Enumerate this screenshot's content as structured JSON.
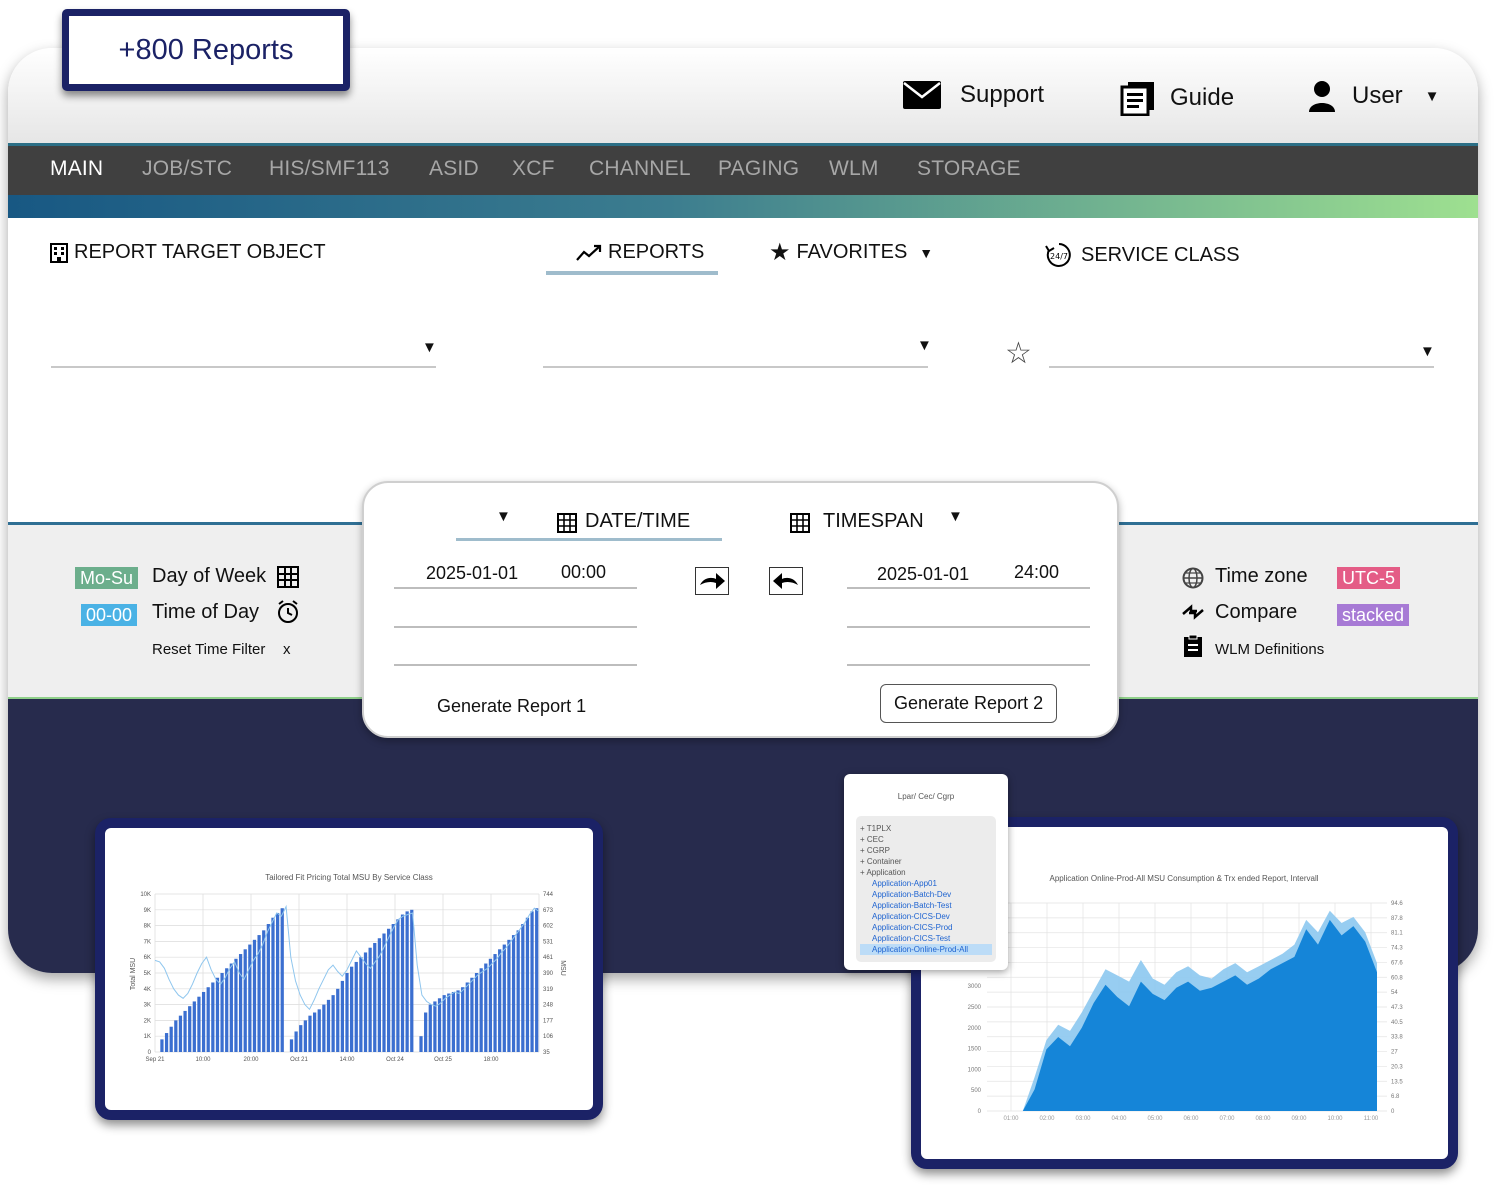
{
  "badge": {
    "text": "+800 Reports"
  },
  "header": {
    "support": "Support",
    "guide": "Guide",
    "user": "User",
    "icons": {
      "support": "envelope-icon",
      "guide": "book-icon",
      "user": "user-icon"
    }
  },
  "nav": {
    "tabs": [
      "MAIN",
      "JOB/STC",
      "HIS/SMF113",
      "ASID",
      "XCF",
      "CHANNEL",
      "PAGING",
      "WLM",
      "STORAGE"
    ],
    "active": "MAIN"
  },
  "sections": {
    "report_target": "REPORT TARGET OBJECT",
    "reports": "REPORTS",
    "favorites": "FAVORITES",
    "service_class": "SERVICE CLASS"
  },
  "filters": {
    "day_of_week_pill": "Mo-Su",
    "day_of_week_label": "Day of Week",
    "time_of_day_pill": "00-00",
    "time_of_day_label": "Time of Day",
    "reset": "Reset Time Filter",
    "reset_x": "x",
    "time_zone_label": "Time zone",
    "time_zone_value": "UTC-5",
    "compare_label": "Compare",
    "compare_value": "stacked",
    "wlm_definitions": "WLM Definitions"
  },
  "datetime_panel": {
    "date_time_label": "DATE/TIME",
    "timespan_label": "TIMESPAN",
    "start_date": "2025-01-01",
    "start_time": "00:00",
    "end_date": "2025-01-01",
    "end_time": "24:00",
    "generate_1": "Generate Report 1",
    "generate_2": "Generate Report 2"
  },
  "tree": {
    "title": "Lpar/ Cec/ Cgrp",
    "items": [
      {
        "label": "T1PLX",
        "level": 0
      },
      {
        "label": "CEC",
        "level": 0
      },
      {
        "label": "CGRP",
        "level": 0
      },
      {
        "label": "Container",
        "level": 0
      },
      {
        "label": "Application",
        "level": 0
      },
      {
        "label": "Application-App01",
        "level": 1
      },
      {
        "label": "Application-Batch-Dev",
        "level": 1
      },
      {
        "label": "Application-Batch-Test",
        "level": 1
      },
      {
        "label": "Application-CICS-Dev",
        "level": 1
      },
      {
        "label": "Application-CICS-Prod",
        "level": 1
      },
      {
        "label": "Application-CICS-Test",
        "level": 1
      },
      {
        "label": "Application-Online-Prod-All",
        "level": 1,
        "selected": true
      }
    ]
  },
  "colors": {
    "navy": "#1b2266",
    "dark_band": "#272b4d",
    "pill_green": "#6cae8c",
    "pill_blue": "#4ab2e5",
    "pill_pink": "#e45c86",
    "pill_purple": "#a77ad5",
    "bar_blue": "#3b6fd0",
    "area_dark": "#1585d8",
    "area_light": "#8cc8ef"
  },
  "chart_data": [
    {
      "type": "bar",
      "title": "Tailored Fit Pricing Total MSU By Service Class",
      "ylabel": "Total MSU",
      "y2label": "MSU",
      "ylim": [
        0,
        10000
      ],
      "y2lim": [
        35,
        744
      ],
      "yticks": [
        "0",
        "1K",
        "2K",
        "3K",
        "4K",
        "5K",
        "6K",
        "7K",
        "8K",
        "9K",
        "10K"
      ],
      "y2ticks": [
        "35",
        "106",
        "177",
        "248",
        "319",
        "390",
        "461",
        "531",
        "602",
        "673",
        "744"
      ],
      "xticks": [
        "Sep 21",
        "10:00",
        "20:00",
        "Oct 21",
        "14:00",
        "Oct 24",
        "Oct 25",
        "18:00"
      ],
      "bar_values": [
        0,
        800,
        1200,
        1600,
        2000,
        2300,
        2600,
        2900,
        3200,
        3500,
        3800,
        4100,
        4400,
        4700,
        5000,
        5300,
        5600,
        5900,
        6200,
        6500,
        6800,
        7100,
        7400,
        7700,
        8100,
        8500,
        8800,
        9100,
        0,
        800,
        1300,
        1700,
        2000,
        2300,
        2500,
        2700,
        3000,
        3300,
        3600,
        4000,
        4500,
        5000,
        5400,
        5700,
        6000,
        6300,
        6600,
        6900,
        7200,
        7500,
        7800,
        8100,
        8400,
        8700,
        8900,
        9000,
        0,
        1000,
        2500,
        3000,
        3200,
        3400,
        3600,
        3700,
        3800,
        3900,
        4100,
        4400,
        4700,
        5000,
        5300,
        5600,
        5900,
        6200,
        6500,
        6800,
        7100,
        7400,
        7700,
        8100,
        8500,
        8900,
        9100
      ],
      "line_values": [
        5800,
        5700,
        5300,
        4600,
        4000,
        3600,
        3400,
        3700,
        4300,
        5000,
        5600,
        6000,
        5200,
        4600,
        4300,
        4700,
        5300,
        5700,
        5000,
        4600,
        5200,
        5800,
        6200,
        6800,
        7600,
        8200,
        8800,
        8600,
        9200,
        6000,
        4500,
        3600,
        3000,
        2700,
        3300,
        4000,
        4600,
        5200,
        5500,
        5100,
        4800,
        5200,
        5800,
        6400,
        6000,
        5600,
        5300,
        5700,
        6100,
        6700,
        7300,
        7900,
        8400,
        8600,
        8700,
        8800,
        5500,
        3600,
        3200,
        3000,
        2900,
        3100,
        3400,
        3600,
        3800,
        3700,
        4000,
        4300,
        4600,
        4900,
        5100,
        5300,
        5600,
        5900,
        6300,
        6600,
        7000,
        7400,
        7800,
        8200,
        8700,
        9100,
        8900
      ]
    },
    {
      "type": "area",
      "title": "Application Online-Prod-All MSU Consumption & Trx ended Report, Intervall",
      "ylim": [
        0,
        5000
      ],
      "yticks": [
        "0",
        "500",
        "1000",
        "1500",
        "2000",
        "2500",
        "3000",
        "3500",
        "4000",
        "4500"
      ],
      "y2ticks": [
        "0",
        "6.8",
        "13.5",
        "20.3",
        "27",
        "33.8",
        "40.5",
        "47.3",
        "54",
        "60.8",
        "67.6",
        "74.3",
        "81.1",
        "87.8",
        "94.6"
      ],
      "xticks": [
        "01:00",
        "02:00",
        "03:00",
        "04:00",
        "05:00",
        "06:00",
        "07:00",
        "08:00",
        "09:00",
        "10:00",
        "11:00"
      ],
      "series": [
        {
          "name": "",
          "values": [
            0,
            0,
            1100,
            2300,
            2800,
            2600,
            3200,
            3900,
            4600,
            4400,
            4200,
            4900,
            4300,
            4100,
            4500,
            4700,
            4400,
            4300,
            4600,
            4800,
            4500,
            4700,
            4900,
            5100,
            5400,
            6200,
            5800,
            6500,
            6100,
            6300,
            5800,
            4800
          ]
        },
        {
          "name": "",
          "values": [
            0,
            0,
            700,
            2000,
            2400,
            2100,
            2700,
            3500,
            4100,
            3700,
            3400,
            4200,
            3800,
            3600,
            4000,
            4200,
            3900,
            4000,
            4200,
            4400,
            4100,
            4300,
            4600,
            4800,
            5000,
            5900,
            5400,
            6200,
            5700,
            6000,
            5500,
            4500
          ]
        }
      ]
    }
  ]
}
